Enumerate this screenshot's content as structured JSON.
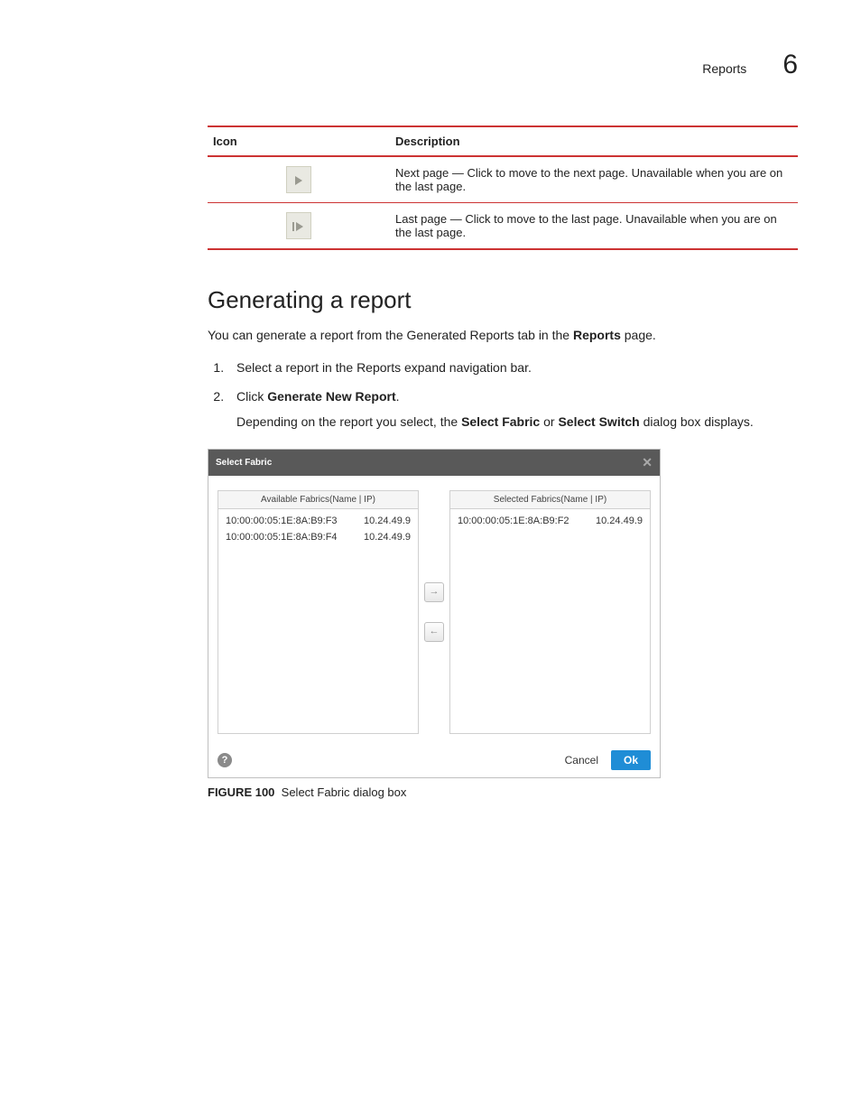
{
  "header": {
    "section": "Reports",
    "chapter": "6"
  },
  "iconTable": {
    "headers": {
      "icon": "Icon",
      "desc": "Description"
    },
    "rows": [
      {
        "desc": "Next page — Click to move to the next page. Unavailable when you are on the last page."
      },
      {
        "desc": "Last page — Click to move to the last page. Unavailable when you are on the last page."
      }
    ]
  },
  "section": {
    "title": "Generating a report",
    "intro_pre": "You can generate a report from the Generated Reports tab in the ",
    "intro_bold": "Reports",
    "intro_post": " page.",
    "step1": "Select a report in the Reports expand navigation bar.",
    "step2_pre": "Click ",
    "step2_bold": "Generate New Report",
    "step2_post": ".",
    "step2_sub_pre": "Depending on the report you select, the ",
    "step2_sub_b1": "Select Fabric",
    "step2_sub_mid": " or ",
    "step2_sub_b2": "Select Switch",
    "step2_sub_post": " dialog box displays."
  },
  "dialog": {
    "title": "Select Fabric",
    "availableHeader": "Available Fabrics(Name | IP)",
    "selectedHeader": "Selected Fabrics(Name | IP)",
    "available": [
      {
        "name": "10:00:00:05:1E:8A:B9:F3",
        "ip": "10.24.49.9"
      },
      {
        "name": "10:00:00:05:1E:8A:B9:F4",
        "ip": "10.24.49.9"
      }
    ],
    "selected": [
      {
        "name": "10:00:00:05:1E:8A:B9:F2",
        "ip": "10.24.49.9"
      }
    ],
    "cancel": "Cancel",
    "ok": "Ok",
    "help": "?"
  },
  "figure": {
    "label": "FIGURE 100",
    "caption": "Select Fabric dialog box"
  }
}
